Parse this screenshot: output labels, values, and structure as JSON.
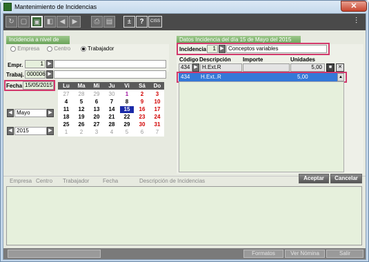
{
  "window": {
    "title": "Mantenimiento de Incidencias",
    "close": "✕"
  },
  "toolbar": {
    "ciss": "CISS",
    "plusminus": "±",
    "help": "?"
  },
  "left": {
    "group_title": "Incidencia a nivel de",
    "radio_empresa": "Empresa",
    "radio_centro": "Centro",
    "radio_trabajador": "Trabajador",
    "empr_label": "Empr.",
    "empr_value": "1",
    "trabaj_label": "Trabaj.",
    "trabaj_value": "000006",
    "fecha_label": "Fecha",
    "fecha_value": "15/05/2015",
    "month": "Mayo",
    "year": "2015"
  },
  "calendar": {
    "headers": [
      "Lu",
      "Ma",
      "Mi",
      "Ju",
      "Vi",
      "Sá",
      "Do"
    ],
    "rows": [
      [
        "27",
        "28",
        "29",
        "30",
        "1",
        "2",
        "3"
      ],
      [
        "4",
        "5",
        "6",
        "7",
        "8",
        "9",
        "10"
      ],
      [
        "11",
        "12",
        "13",
        "14",
        "15",
        "16",
        "17"
      ],
      [
        "18",
        "19",
        "20",
        "21",
        "22",
        "23",
        "24"
      ],
      [
        "25",
        "26",
        "27",
        "28",
        "29",
        "30",
        "31"
      ],
      [
        "1",
        "2",
        "3",
        "4",
        "5",
        "6",
        "7"
      ]
    ]
  },
  "right": {
    "group_title": "Datos Incidencia del día 15 de Mayo del 2015",
    "incidencia_label": "Incidencia",
    "incidencia_value": "1",
    "incidencia_desc": "Conceptos variables",
    "col_codigo": "Código",
    "col_descripcion": "Descripción",
    "col_importe": "Importe",
    "col_unidades": "Unidades",
    "input_codigo": "434",
    "input_desc": "H.Ext.R",
    "input_unidades": "5,00",
    "row_codigo": "434",
    "row_desc": "H.Ext..R",
    "row_unidades": "5,00"
  },
  "bottom": {
    "col_empresa": "Empresa",
    "col_centro": "Centro",
    "col_trabajador": "Trabajador",
    "col_fecha": "Fecha",
    "col_desc": "Descripción de Incidencias",
    "aceptar": "Aceptar",
    "cancelar": "Cancelar"
  },
  "statusbar": {
    "formatos": "Formatos",
    "ver_nomina": "Ver Nómina",
    "salir": "Salir"
  },
  "colors": {
    "accent_green": "#6aa35a",
    "highlight": "#d1376b",
    "selected_row": "#3478d8"
  }
}
